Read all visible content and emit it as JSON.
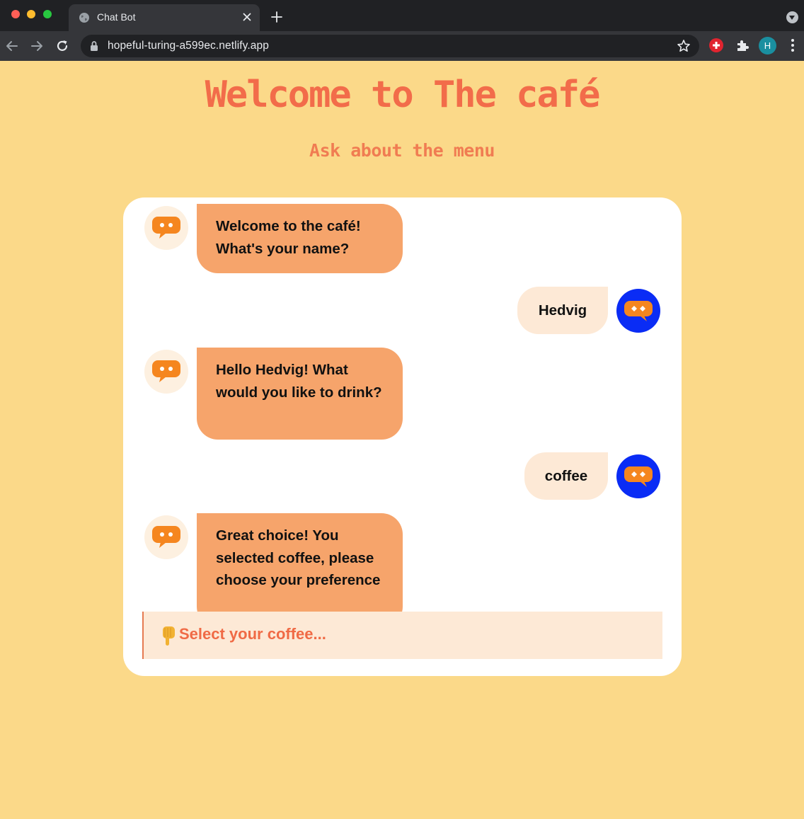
{
  "browser": {
    "tab_title": "Chat Bot",
    "url": "hopeful-turing-a599ec.netlify.app",
    "profile_initial": "H"
  },
  "page": {
    "title": "Welcome to The café",
    "subtitle": "Ask about the menu"
  },
  "messages": [
    {
      "from": "bot",
      "text": "Welcome to the café! What's your name?"
    },
    {
      "from": "user",
      "text": "Hedvig"
    },
    {
      "from": "bot",
      "text": "Hello Hedvig! What would you like to drink?"
    },
    {
      "from": "user",
      "text": "coffee"
    },
    {
      "from": "bot",
      "text": "Great choice! You selected coffee, please choose your preference"
    }
  ],
  "input": {
    "icon": "pointing-down-hand-icon",
    "placeholder": "Select your coffee..."
  },
  "colors": {
    "page_background": "#fbd989",
    "title": "#f26c4a",
    "bot_bubble": "#f6a46b",
    "user_bubble": "#fde9d6",
    "user_avatar": "#0a2cf5",
    "bot_icon": "#f5861f"
  }
}
